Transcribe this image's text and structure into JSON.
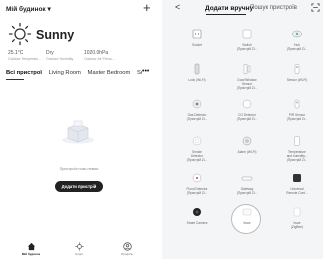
{
  "left": {
    "home_name": "Мій будинок",
    "caret": "▾",
    "plus": "+",
    "weather": "Sunny",
    "stats": [
      {
        "value": "25.1°C",
        "label": "Outdoor Temperatu..."
      },
      {
        "value": "Dry",
        "label": "Outdoor Humidity"
      },
      {
        "value": "1020.0hPa",
        "label": "Outdoor Air Press..."
      }
    ],
    "tabs": [
      {
        "label": "Всі пристрої",
        "active": true
      },
      {
        "label": "Living Room",
        "active": false
      },
      {
        "label": "Master Bedroom",
        "active": false
      },
      {
        "label": "Sı",
        "active": false
      }
    ],
    "more": "•••",
    "empty_text": "Пристроїв поки немає",
    "add_button": "Додати пристрій",
    "nav": [
      {
        "icon": "home-icon",
        "label": "Мій будинок",
        "active": true
      },
      {
        "icon": "smart-icon",
        "label": "Smart",
        "active": false
      },
      {
        "icon": "profile-icon",
        "label": "Профіль",
        "active": false
      }
    ]
  },
  "right": {
    "back": "<",
    "tab_manual": "Додати вручну",
    "tab_search": "Пошук пристроїв",
    "devices": [
      {
        "name": "Socket",
        "icon": "socket-icon"
      },
      {
        "name": "Switch\n(Пристрій Zi...",
        "icon": "switch-icon"
      },
      {
        "name": "Hub\n(Пристрій Zi...",
        "icon": "hub-icon"
      },
      {
        "name": "Lock (Wi-Fi)",
        "icon": "lock-icon"
      },
      {
        "name": "Door/Window\nSensor\n(Пристрій Zi...",
        "icon": "door-sensor-icon"
      },
      {
        "name": "Sensor (Wi-Fi)",
        "icon": "sensor-icon"
      },
      {
        "name": "Gas Detector\n(Пристрій Zi...",
        "icon": "gas-detector-icon"
      },
      {
        "name": "CO Detector\n(Пристрій Zi...",
        "icon": "co-detector-icon"
      },
      {
        "name": "PIR Sensor\n(Пристрій Zi...",
        "icon": "pir-sensor-icon"
      },
      {
        "name": "Smoke\nDetector\n(Пристрій Zi...",
        "icon": "smoke-detector-icon"
      },
      {
        "name": "Alarm (Wi-Fi)",
        "icon": "alarm-icon"
      },
      {
        "name": "Temperature\nand humidity...\n(Пристрій Zi...",
        "icon": "temp-humidity-icon"
      },
      {
        "name": "Flood Detector\n(Пристрій Zi...",
        "icon": "flood-detector-icon"
      },
      {
        "name": "Gateway\n(Пристрій Zi...",
        "icon": "gateway-icon"
      },
      {
        "name": "Universal\nRemote Cont...",
        "icon": "remote-icon"
      },
      {
        "name": "Smart Camera",
        "icon": "camera-icon"
      },
      {
        "name": "Інше",
        "icon": "other-icon"
      },
      {
        "name": "Інше\n(ZigBee)",
        "icon": "other-zigbee-icon"
      }
    ]
  }
}
